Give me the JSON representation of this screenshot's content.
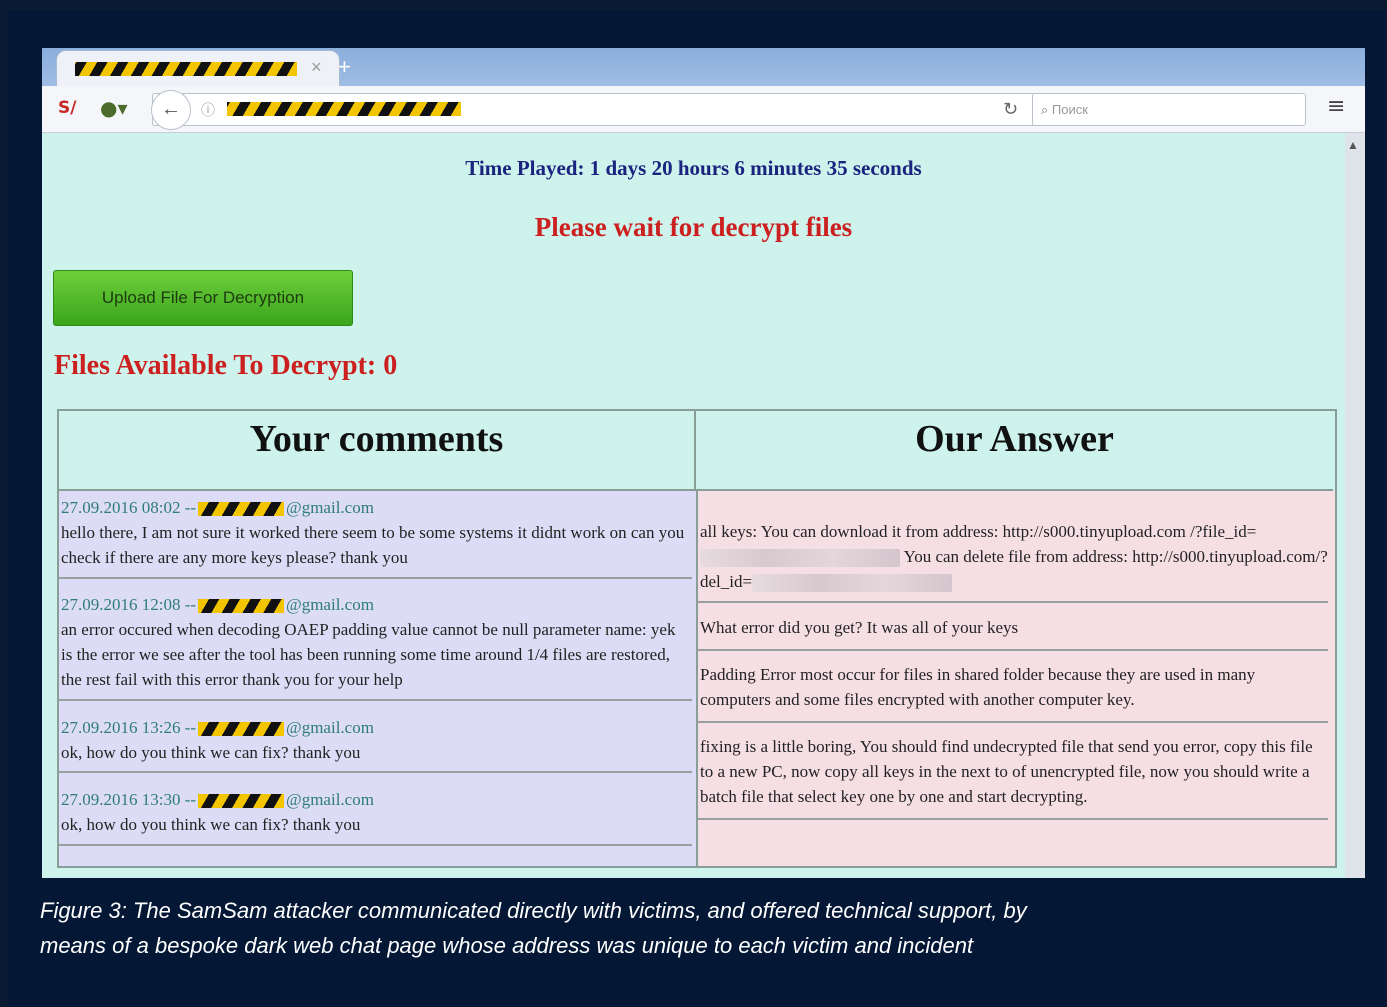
{
  "browser": {
    "tab_close_glyph": "×",
    "newtab_glyph": "+",
    "search_placeholder": "Поиск",
    "icons": [
      "sj-addon-icon",
      "onion-icon",
      "back-icon",
      "info-icon",
      "reload-icon",
      "search-icon",
      "menu-icon"
    ]
  },
  "page": {
    "time_played": "Time Played: 1 days 20 hours 6 minutes 35 seconds",
    "wait_message": "Please wait for decrypt files",
    "upload_button": "Upload File For Decryption",
    "files_available": "Files Available To Decrypt: 0",
    "table": {
      "headers": [
        "Your comments",
        "Our Answer"
      ],
      "comments": [
        {
          "date": "27.09.2016 08:02 --",
          "email_suffix": "@gmail.com",
          "text": "hello there, I am not sure it worked there seem to be some systems it didnt work on can you check if there are any more keys please? thank you"
        },
        {
          "date": "27.09.2016 12:08 --",
          "email_suffix": "@gmail.com",
          "text": "an error occured when decoding OAEP padding value cannot be null parameter name: yek is the error we see after the tool has been running some time around 1/4 files are restored, the rest fail with this error thank you for your help"
        },
        {
          "date": "27.09.2016 13:26 --",
          "email_suffix": "@gmail.com",
          "text": "ok, how do you think we can fix? thank you"
        },
        {
          "date": "27.09.2016 13:30 --",
          "email_suffix": "@gmail.com",
          "text": "ok, how do you think we can fix? thank you"
        }
      ],
      "answers": [
        {
          "part1": "all keys: You can download it from address: http://s000.tinyupload.com /?file_id=",
          "part2": " You can delete file from address: http://s000.tinyupload.com/?del_id="
        },
        {
          "text": "What error did you get? It was all of your keys"
        },
        {
          "text": "Padding Error most occur for files in shared folder because they are used in many computers and some files encrypted with another computer key."
        },
        {
          "text": "fixing is a little boring, You should find undecrypted file that send you error, copy this file to a new PC, now copy all keys in the next to of unencrypted file, now you should write a batch file that select key one by one and start decrypting."
        }
      ]
    }
  },
  "caption": "Figure 3: The SamSam attacker communicated directly with victims, and offered technical support, by means of a bespoke dark web chat page whose address was unique to each victim and incident",
  "colors": {
    "background": "#041836",
    "page_bg": "#cdf3ec",
    "accent_red": "#cc1f1f",
    "accent_blue": "#1a237e",
    "button_green": "#4fb928"
  }
}
